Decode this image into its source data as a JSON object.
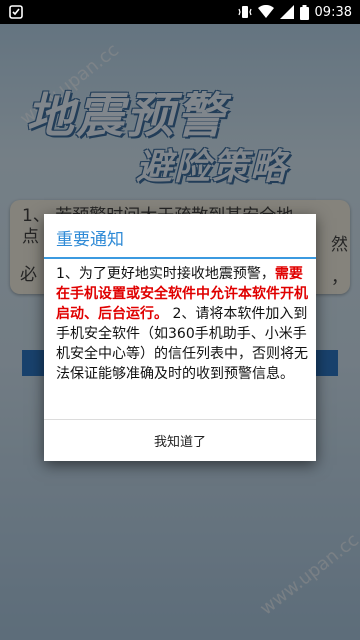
{
  "status_bar": {
    "time": "09:38"
  },
  "background": {
    "watermark": "www.upan.cc",
    "title_line1": "地震预警",
    "title_line2": "避险策略",
    "board_line1": "1、 若预警时间大于疏散到某安全地",
    "board_line1_cont": "点",
    "board_right_1": "然",
    "board_bottom": "必",
    "board_bottom_right": "，"
  },
  "dialog": {
    "title": "重要通知",
    "message_part1": "1、为了更好地实时接收地震预警，",
    "message_red": "需要在手机设置或安全软件中允许本软件开机启动、后台运行。",
    "message_part2": " 2、请将本软件加入到手机安全软件（如360手机助手、小米手机安全中心等）的信任列表中，否则将无法保证能够准确及时的收到预警信息。",
    "button_label": "我知道了"
  },
  "colors": {
    "accent": "#2e8ad6",
    "warning_text": "#e00000",
    "app_blue": "#2e79c6"
  }
}
